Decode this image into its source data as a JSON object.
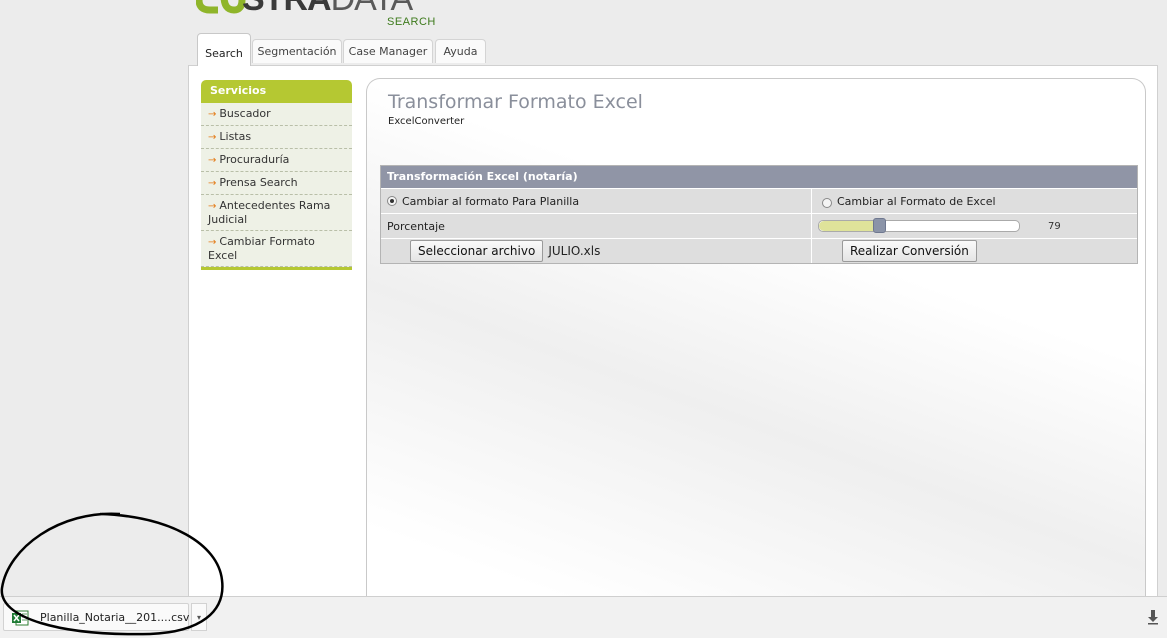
{
  "logo": {
    "text_bold": "STRA",
    "text_thin": "DATA",
    "sub": "SEARCH"
  },
  "tabs": [
    {
      "label": "Search",
      "active": true
    },
    {
      "label": "Segmentación",
      "active": false
    },
    {
      "label": "Case Manager",
      "active": false
    },
    {
      "label": "Ayuda",
      "active": false
    }
  ],
  "sidebar": {
    "title": "Servicios",
    "items": [
      {
        "label": "Buscador"
      },
      {
        "label": "Listas"
      },
      {
        "label": "Procuraduría"
      },
      {
        "label": "Prensa Search"
      },
      {
        "label": "Antecedentes Rama Judicial"
      },
      {
        "label": "Cambiar Formato Excel"
      }
    ],
    "arrow_icon": "arrow-right-icon"
  },
  "panel": {
    "title": "Transformar Formato Excel",
    "subtitle": "ExcelConverter"
  },
  "form": {
    "header": "Transformación Excel (notaría)",
    "radio_planilla": {
      "label": "Cambiar al formato Para Planilla",
      "checked": true
    },
    "radio_excel": {
      "label": "Cambiar al Formato de Excel",
      "checked": false
    },
    "percentage_label": "Porcentaje",
    "slider": {
      "value": 79,
      "value_text": "79",
      "fraction": 0.3
    },
    "select_file_label": "Seleccionar archivo",
    "file_name": "JULIO.xls",
    "convert_label": "Realizar Conversión"
  },
  "download_bar": {
    "file_name": "Planilla_Notaria__201....csv",
    "file_icon": "excel-file-icon",
    "menu_icon": "caret-down-icon",
    "downloads_icon": "download-arrow-icon"
  },
  "colors": {
    "accent_green": "#b5c832",
    "table_header": "#9095a6",
    "title_gray": "#8a8f9b",
    "arrow_orange": "#e47b17"
  }
}
